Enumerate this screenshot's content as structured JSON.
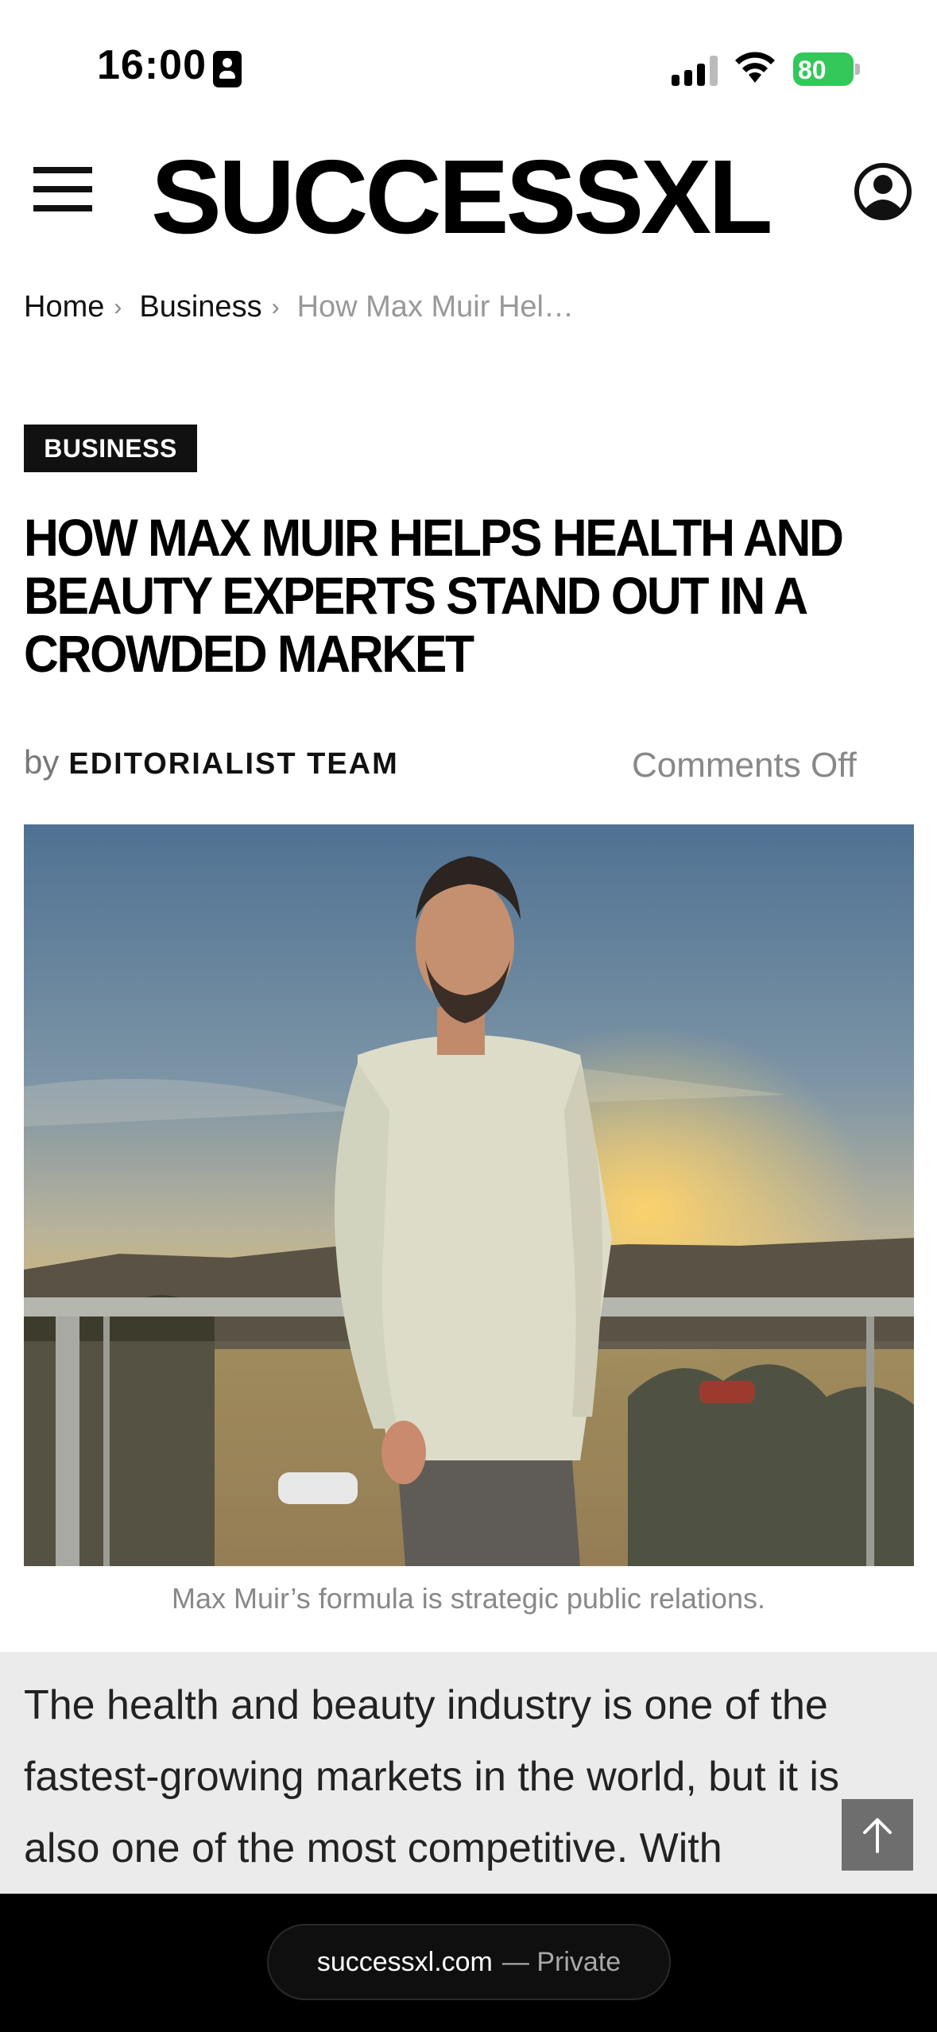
{
  "status_bar": {
    "time": "16:00",
    "battery": "80"
  },
  "header": {
    "logo": "SUCCESSXL"
  },
  "breadcrumb": {
    "home": "Home",
    "section": "Business",
    "current": "How Max Muir Hel…",
    "separator": "›"
  },
  "article": {
    "category": "BUSINESS",
    "title": "HOW MAX MUIR HELPS HEALTH AND BEAUTY EXPERTS STAND OUT IN A CROWDED MARKET",
    "by": "by",
    "author": "EDITORIALIST TEAM",
    "comments": "Comments Off",
    "caption": "Max Muir’s formula is strategic public relations.",
    "body": "The health and beauty industry is one of the fastest-growing markets in the world, but it is also one of the most competitive. With"
  },
  "browser": {
    "domain": "successxl.com",
    "mode": "— Private"
  },
  "colors": {
    "accent_dark": "#111111",
    "battery_green": "#34c759",
    "body_panel": "#ebebeb"
  },
  "icons": [
    "id-card-icon",
    "cellular-signal-icon",
    "wifi-icon",
    "battery-icon",
    "hamburger-menu-icon",
    "account-icon",
    "arrow-up-icon"
  ]
}
